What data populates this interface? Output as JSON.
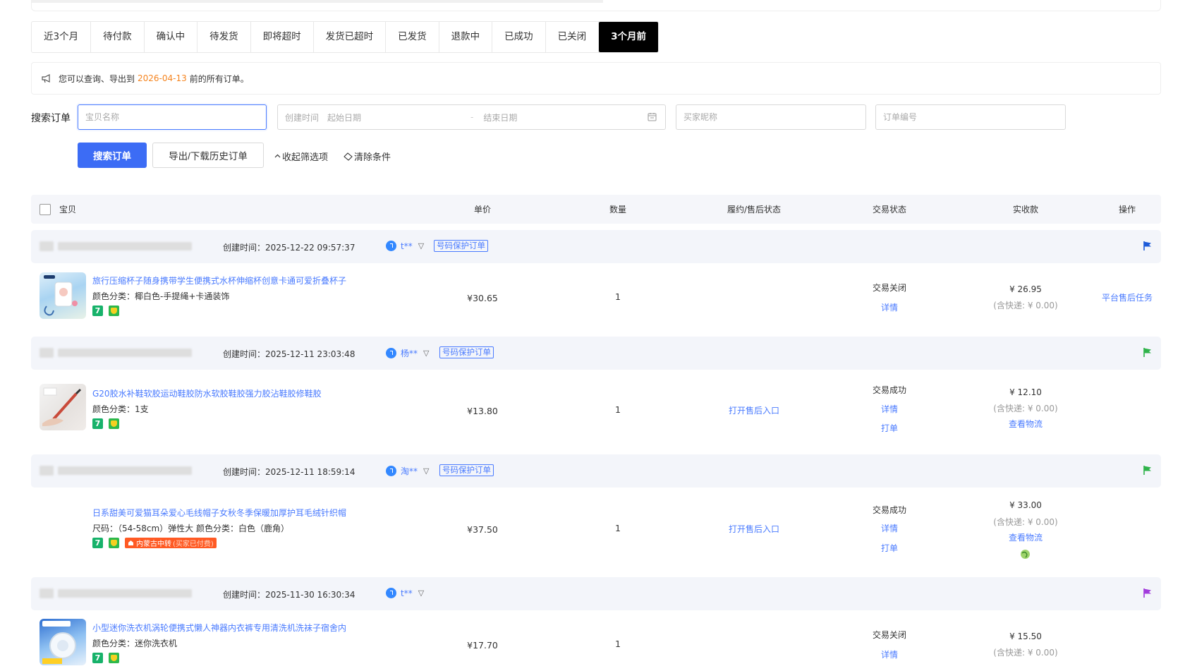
{
  "tabs": [
    {
      "label": "近3个月"
    },
    {
      "label": "待付款"
    },
    {
      "label": "确认中"
    },
    {
      "label": "待发货"
    },
    {
      "label": "即将超时"
    },
    {
      "label": "发货已超时"
    },
    {
      "label": "已发货"
    },
    {
      "label": "退款中"
    },
    {
      "label": "已成功"
    },
    {
      "label": "已关闭"
    },
    {
      "label": "3个月前"
    }
  ],
  "notice": {
    "prefix": "您可以查询、导出到",
    "date": "2026-04-13",
    "suffix": "前的所有订单。"
  },
  "search": {
    "label": "搜索订单",
    "item_placeholder": "宝贝名称",
    "created_label": "创建时间",
    "start_placeholder": "起始日期",
    "end_placeholder": "结束日期",
    "date_sep": "-",
    "buyer_placeholder": "买家昵称",
    "order_placeholder": "订单编号",
    "search_btn": "搜索订单",
    "export_btn": "导出/下载历史订单",
    "collapse": "收起筛选项",
    "clear": "清除条件"
  },
  "table_header": {
    "item": "宝贝",
    "price": "单价",
    "qty": "数量",
    "fulfill": "履约/售后状态",
    "status": "交易状态",
    "paid": "实收款",
    "action": "操作"
  },
  "colors": {
    "accent": "#3c6cf5",
    "link": "#4a7bff",
    "orange": "#f5841f"
  },
  "orders": [
    {
      "created": "创建时间：2025-12-22 09:57:37",
      "buyer": "t**",
      "protect": "号码保护订单",
      "flag_color": "#1d5bd8",
      "title": "旅行压缩杯子随身携带学生便携式水杯伸缩杯创意卡通可爱折叠杯子",
      "sku": "颜色分类：椰白色-手提绳+卡通装饰",
      "price": "¥30.65",
      "qty": "1",
      "fulfill": "",
      "status": "交易关闭",
      "detail": "详情",
      "amount": "¥ 26.95",
      "shipping": "(含快递: ¥ 0.00)",
      "action": "平台售后任务"
    },
    {
      "created": "创建时间：2025-12-11 23:03:48",
      "buyer": "杨**",
      "protect": "号码保护订单",
      "flag_color": "#2fb34a",
      "title": "G20胶水补鞋软胶运动鞋胶防水软胶鞋胶强力胶沾鞋胶修鞋胶",
      "sku": "颜色分类：1支",
      "price": "¥13.80",
      "qty": "1",
      "fulfill": "打开售后入口",
      "status": "交易成功",
      "detail": "详情",
      "print": "打单",
      "amount": "¥ 12.10",
      "shipping": "(含快递: ¥ 0.00)",
      "logistics": "查看物流"
    },
    {
      "created": "创建时间：2025-12-11 18:59:14",
      "buyer": "淘**",
      "protect": "号码保护订单",
      "flag_color": "#2fb34a",
      "title": "日系甜美可爱猫耳朵爱心毛线帽子女秋冬季保暖加厚护耳毛绒针织帽",
      "sku": "尺码：（54-58cm）弹性大   颜色分类：白色（鹿角）",
      "transit": "内蒙古中转",
      "transit_sub": "(买家已付费)",
      "price": "¥37.50",
      "qty": "1",
      "fulfill": "打开售后入口",
      "status": "交易成功",
      "detail": "详情",
      "print": "打单",
      "amount": "¥ 33.00",
      "shipping": "(含快递: ¥ 0.00)",
      "logistics": "查看物流"
    },
    {
      "created": "创建时间：2025-11-30 16:30:34",
      "buyer": "t**",
      "protect": "",
      "flag_color": "#a23bdc",
      "title": "小型迷你洗衣机涡轮便携式懒人神器内衣裤专用清洗机洗袜子宿舍内",
      "sku": "颜色分类：迷你洗衣机",
      "price": "¥17.70",
      "qty": "1",
      "fulfill": "",
      "status": "交易关闭",
      "detail": "详情",
      "amount": "¥ 15.50",
      "shipping": "(含快递: ¥ 0.00)"
    }
  ]
}
